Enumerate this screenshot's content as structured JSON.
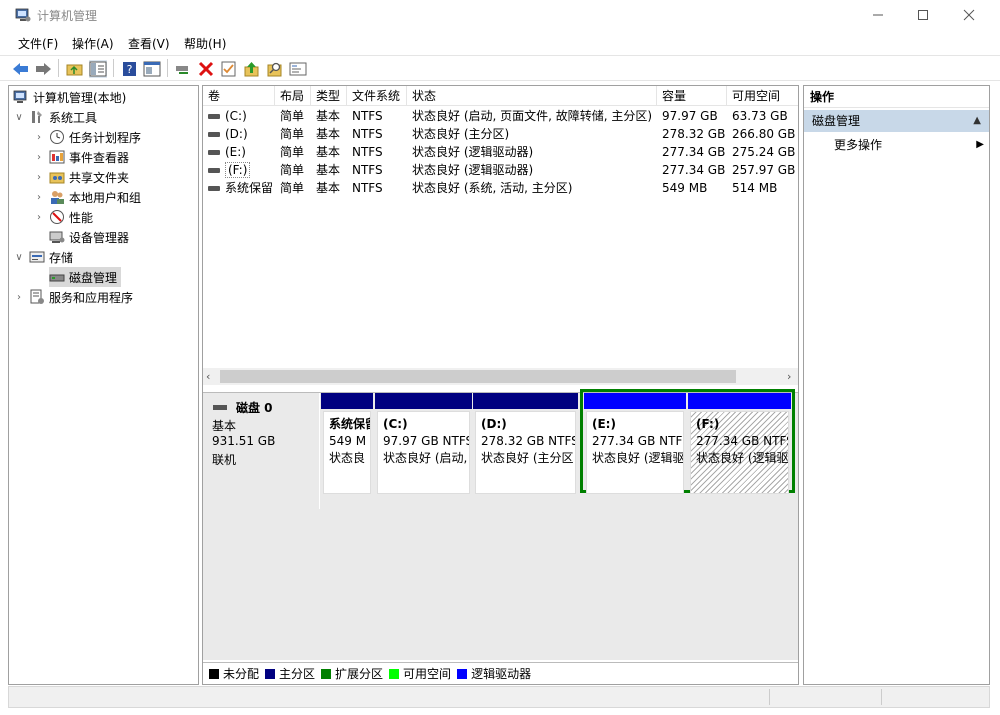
{
  "window": {
    "title": "计算机管理"
  },
  "menu": [
    "文件(F)",
    "操作(A)",
    "查看(V)",
    "帮助(H)"
  ],
  "toolbar": [
    "back-icon",
    "forward-icon",
    "up-folder-icon",
    "show-tree-icon",
    "help-icon",
    "properties-icon",
    "connect-icon",
    "delete-icon",
    "check-icon",
    "up-arrow-icon",
    "search-icon",
    "console-icon"
  ],
  "tree": {
    "root": "计算机管理(本地)",
    "system_tools": "系统工具",
    "task_scheduler": "任务计划程序",
    "event_viewer": "事件查看器",
    "shared_folders": "共享文件夹",
    "local_users": "本地用户和组",
    "performance": "性能",
    "device_manager": "设备管理器",
    "storage": "存储",
    "disk_management": "磁盘管理",
    "services_apps": "服务和应用程序"
  },
  "volumes": {
    "headers": [
      "卷",
      "布局",
      "类型",
      "文件系统",
      "状态",
      "容量",
      "可用空间"
    ],
    "rows": [
      {
        "vol": "(C:)",
        "layout": "简单",
        "type": "基本",
        "fs": "NTFS",
        "status": "状态良好 (启动, 页面文件, 故障转储, 主分区)",
        "cap": "97.97 GB",
        "free": "63.73 GB"
      },
      {
        "vol": "(D:)",
        "layout": "简单",
        "type": "基本",
        "fs": "NTFS",
        "status": "状态良好 (主分区)",
        "cap": "278.32 GB",
        "free": "266.80 GB"
      },
      {
        "vol": "(E:)",
        "layout": "简单",
        "type": "基本",
        "fs": "NTFS",
        "status": "状态良好 (逻辑驱动器)",
        "cap": "277.34 GB",
        "free": "275.24 GB"
      },
      {
        "vol": "(F:)",
        "layout": "简单",
        "type": "基本",
        "fs": "NTFS",
        "status": "状态良好 (逻辑驱动器)",
        "cap": "277.34 GB",
        "free": "257.97 GB"
      },
      {
        "vol": "系统保留",
        "layout": "简单",
        "type": "基本",
        "fs": "NTFS",
        "status": "状态良好 (系统, 活动, 主分区)",
        "cap": "549 MB",
        "free": "514 MB"
      }
    ]
  },
  "disk": {
    "name": "磁盘 0",
    "type": "基本",
    "size": "931.51 GB",
    "state": "联机",
    "partitions": [
      {
        "name": "系统保留",
        "size": "549 M",
        "status": "状态良"
      },
      {
        "name": "(C:)",
        "size": "97.97 GB NTFS",
        "status": "状态良好 (启动,"
      },
      {
        "name": "(D:)",
        "size": "278.32 GB NTFS",
        "status": "状态良好 (主分区"
      },
      {
        "name": "(E:)",
        "size": "277.34 GB NTF",
        "status": "状态良好 (逻辑驱"
      },
      {
        "name": "(F:)",
        "size": "277.34 GB NTFS",
        "status": "状态良好 (逻辑驱"
      }
    ]
  },
  "legend": [
    {
      "label": "未分配",
      "color": "#000000"
    },
    {
      "label": "主分区",
      "color": "#000080"
    },
    {
      "label": "扩展分区",
      "color": "#008000"
    },
    {
      "label": "可用空间",
      "color": "#00ff00"
    },
    {
      "label": "逻辑驱动器",
      "color": "#0000ff"
    }
  ],
  "actions": {
    "title": "操作",
    "section": "磁盘管理",
    "more": "更多操作"
  }
}
